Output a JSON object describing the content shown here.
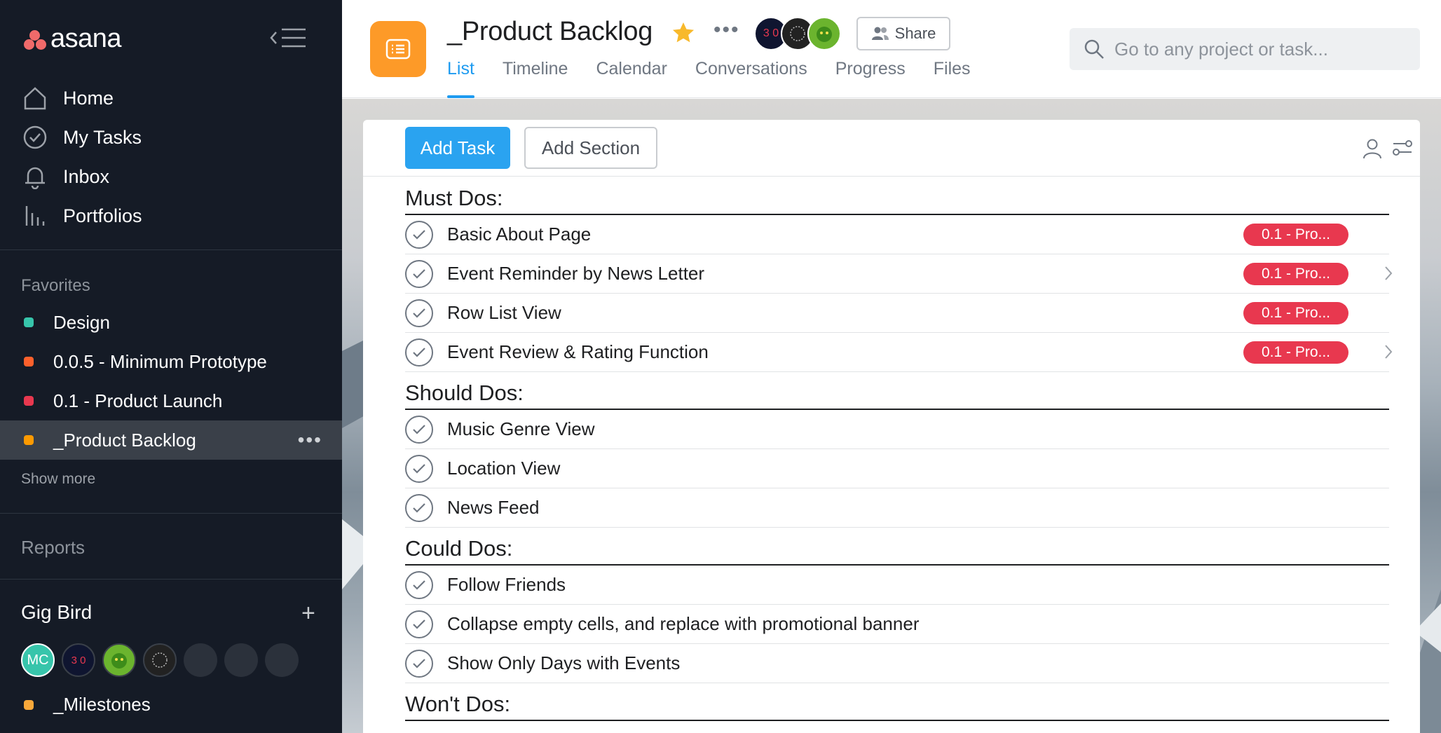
{
  "app": {
    "logo_text": "asana"
  },
  "sidebar": {
    "nav": [
      {
        "label": "Home",
        "icon": "home-icon"
      },
      {
        "label": "My Tasks",
        "icon": "check-circle-icon"
      },
      {
        "label": "Inbox",
        "icon": "bell-icon"
      },
      {
        "label": "Portfolios",
        "icon": "bar-chart-icon"
      }
    ],
    "favorites_heading": "Favorites",
    "favorites": [
      {
        "label": "Design",
        "color": "#37c5ab"
      },
      {
        "label": "0.0.5 - Minimum Prototype",
        "color": "#fd612c"
      },
      {
        "label": "0.1 - Product Launch",
        "color": "#e8384f"
      },
      {
        "label": "_Product Backlog",
        "color": "#fd9a00",
        "active": true
      }
    ],
    "show_more": "Show more",
    "reports_heading": "Reports",
    "team": {
      "name": "Gig Bird",
      "avatars": [
        {
          "initials": "MC",
          "color": "#37c5ab"
        },
        {
          "initials": "3 0",
          "color": "#0f1530"
        },
        {
          "initials": "",
          "color": "#6bb42e"
        },
        {
          "initials": "",
          "color": "#222222"
        },
        {
          "initials": "",
          "color": "#2b313b"
        },
        {
          "initials": "",
          "color": "#2b313b"
        },
        {
          "initials": "",
          "color": "#2b313b"
        }
      ],
      "project": "_Milestones"
    }
  },
  "header": {
    "title": "_Product Backlog",
    "share_label": "Share",
    "tabs": [
      "List",
      "Timeline",
      "Calendar",
      "Conversations",
      "Progress",
      "Files"
    ],
    "active_tab": "List",
    "members": [
      {
        "initials": "3 0",
        "color": "#0f1530"
      },
      {
        "initials": "",
        "color": "#222222"
      },
      {
        "initials": "",
        "color": "#6bb42e"
      }
    ],
    "search_placeholder": "Go to any project or task..."
  },
  "toolbar": {
    "add_task": "Add Task",
    "add_section": "Add Section"
  },
  "sections": [
    {
      "title": "Must Dos:",
      "tasks": [
        {
          "name": "Basic About Page",
          "tag": "0.1 - Pro...",
          "chevron": false
        },
        {
          "name": "Event Reminder by News Letter",
          "tag": "0.1 - Pro...",
          "chevron": true
        },
        {
          "name": "Row List View",
          "tag": "0.1 - Pro...",
          "chevron": false
        },
        {
          "name": "Event Review & Rating Function",
          "tag": "0.1 - Pro...",
          "chevron": true
        }
      ]
    },
    {
      "title": "Should Dos:",
      "tasks": [
        {
          "name": "Music Genre View"
        },
        {
          "name": "Location View"
        },
        {
          "name": "News Feed"
        }
      ]
    },
    {
      "title": "Could Dos:",
      "tasks": [
        {
          "name": "Follow Friends"
        },
        {
          "name": "Collapse empty cells, and replace with promotional banner"
        },
        {
          "name": "Show Only Days with Events"
        }
      ]
    },
    {
      "title": "Won't Dos:",
      "tasks": []
    }
  ],
  "colors": {
    "accent": "#1e9bf0",
    "tag_red": "#e8384f",
    "project_orange": "#fd9a28",
    "sidebar_bg": "#151b26"
  }
}
